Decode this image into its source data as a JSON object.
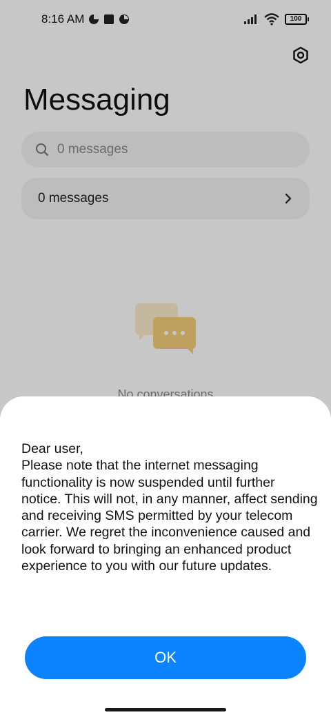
{
  "status_bar": {
    "time": "8:16 AM",
    "battery": "100"
  },
  "header": {
    "title": "Messaging"
  },
  "search": {
    "text": "0 messages"
  },
  "messages_row": {
    "label": "0 messages"
  },
  "empty_state": {
    "label": "No conversations"
  },
  "dialog": {
    "message": "Dear user,\nPlease note that the internet messaging functionality is now suspended until further notice. This will not, in any manner, affect sending and receiving SMS permitted by your telecom carrier. We regret the inconvenience caused and look forward to bringing an enhanced product experience to you with our future updates.",
    "ok_label": "OK"
  },
  "colors": {
    "accent": "#0d84ff",
    "sheet_background": "#ffffff",
    "field_background": "#f2f2f2",
    "illustration": "#f5cf7a"
  },
  "icons": {
    "settings": "gear-icon",
    "search": "search-icon",
    "chevron": "chevron-right-icon",
    "signal": "signal-icon",
    "wifi": "wifi-icon",
    "battery": "battery-icon",
    "empty": "chat-bubbles-icon"
  }
}
